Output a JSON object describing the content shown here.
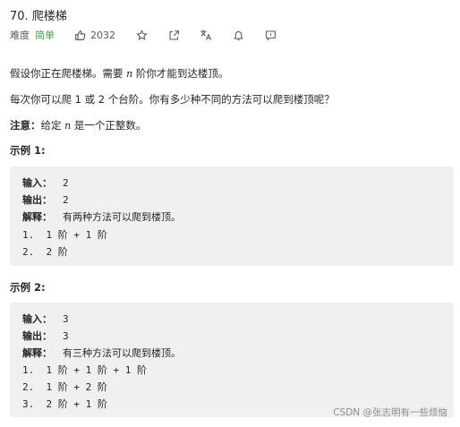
{
  "problem": {
    "title": "70. 爬楼梯",
    "difficulty_label": "难度",
    "difficulty": "简单",
    "likes": "2032"
  },
  "description": {
    "p1_a": "假设你正在爬楼梯。需要 ",
    "p1_n": "n",
    "p1_b": " 阶你才能到达楼顶。",
    "p2": "每次你可以爬 1 或 2 个台阶。你有多少种不同的方法可以爬到楼顶呢？",
    "note_label": "注意：",
    "note_a": "给定 ",
    "note_n": "n",
    "note_b": " 是一个正整数。"
  },
  "examples": [
    {
      "heading": "示例 1:",
      "input_label": "输入：",
      "input": "2",
      "output_label": "输出：",
      "output": "2",
      "explain_label": "解释：",
      "explain": "有两种方法可以爬到楼顶。",
      "steps": [
        "1.  1 阶 + 1 阶",
        "2.  2 阶"
      ]
    },
    {
      "heading": "示例 2:",
      "input_label": "输入：",
      "input": "3",
      "output_label": "输出：",
      "output": "3",
      "explain_label": "解释：",
      "explain": "有三种方法可以爬到楼顶。",
      "steps": [
        "1.  1 阶 + 1 阶 + 1 阶",
        "2.  1 阶 + 2 阶",
        "3.  2 阶 + 1 阶"
      ]
    }
  ],
  "watermark": "CSDN @张志明有一些烦恼",
  "colors": {
    "easy": "#43a047",
    "example_bg": "#f0f0f0"
  },
  "icons": [
    "thumbs-up-icon",
    "star-icon",
    "share-icon",
    "translate-icon",
    "bell-icon",
    "feedback-icon"
  ]
}
